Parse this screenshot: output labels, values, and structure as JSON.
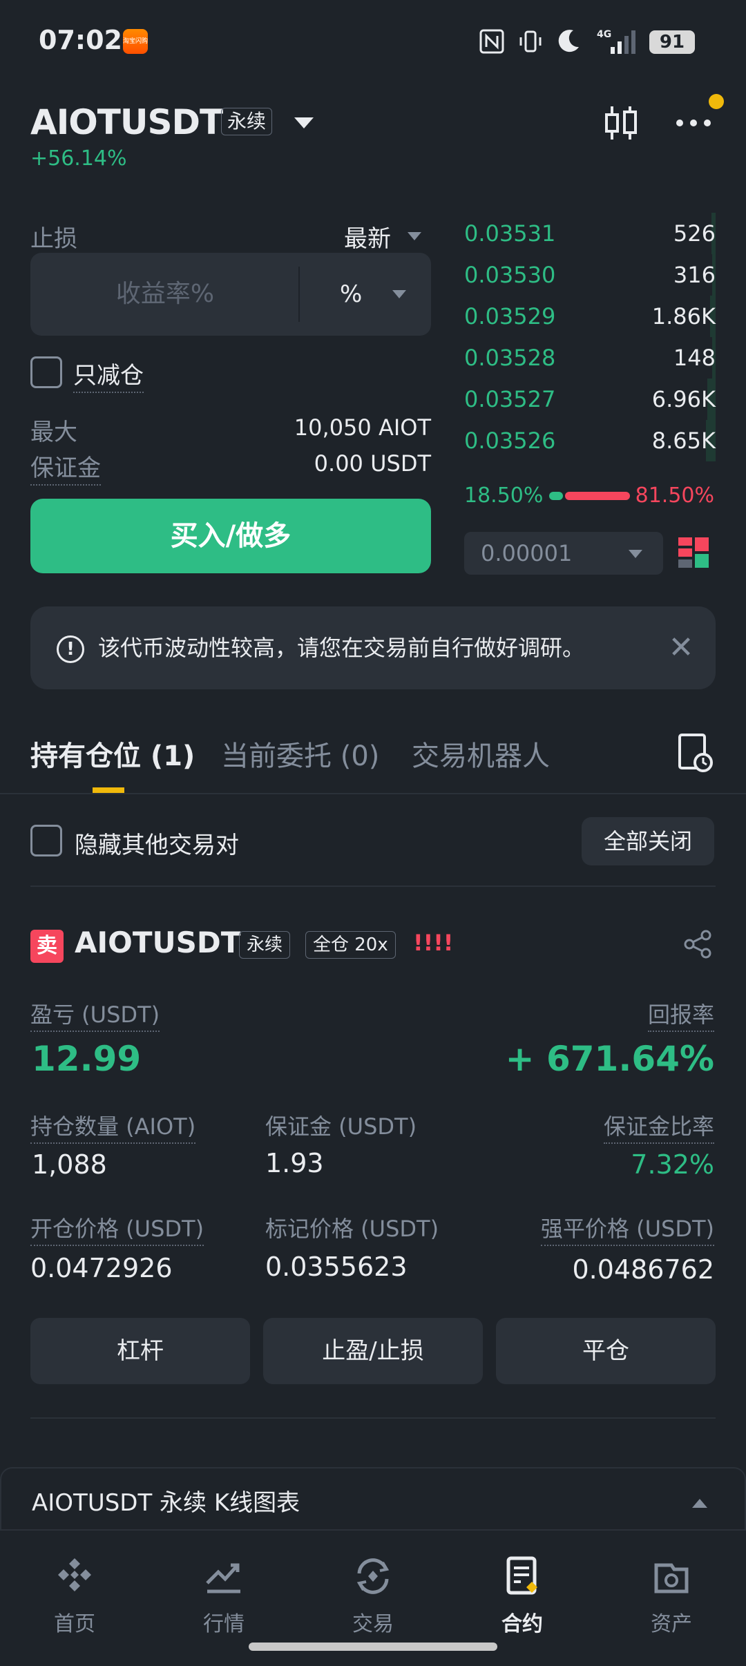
{
  "status_bar": {
    "time": "07:02",
    "app_icon_text": "淘宝闪购",
    "battery": "91",
    "icons": [
      "nfc-icon",
      "vibrate-icon",
      "moon-icon",
      "signal-4g-icon"
    ]
  },
  "header": {
    "pair": "AIOTUSDT",
    "tag": "永续",
    "change": "+56.14%"
  },
  "order_form": {
    "stop_label": "止损",
    "price_type": "最新",
    "input_placeholder": "收益率%",
    "unit": "%",
    "reduce_only": "只减仓",
    "max_label": "最大",
    "max_value": "10,050 AIOT",
    "margin_label": "保证金",
    "margin_value": "0.00 USDT",
    "buy_label": "买入/做多"
  },
  "order_book": {
    "rows": [
      {
        "price": "0.03531",
        "qty": "526",
        "depth": 0.2
      },
      {
        "price": "0.03530",
        "qty": "316",
        "depth": 0.12
      },
      {
        "price": "0.03529",
        "qty": "1.86K",
        "depth": 0.4
      },
      {
        "price": "0.03528",
        "qty": "148",
        "depth": 0.05
      },
      {
        "price": "0.03527",
        "qty": "6.96K",
        "depth": 0.8
      },
      {
        "price": "0.03526",
        "qty": "8.65K",
        "depth": 1.0
      }
    ],
    "buy_ratio": "18.50%",
    "sell_ratio": "81.50%",
    "tick": "0.00001"
  },
  "warning": {
    "text": "该代币波动性较高，请您在交易前自行做好调研。"
  },
  "tabs": [
    {
      "label": "持有仓位 (1)"
    },
    {
      "label": "当前委托 (0)"
    },
    {
      "label": "交易机器人"
    }
  ],
  "filter": {
    "hide_other": "隐藏其他交易对",
    "close_all": "全部关闭"
  },
  "position": {
    "side": "卖",
    "pair": "AIOTUSDT",
    "tag_type": "永续",
    "tag_margin": "全仓 20x",
    "alerts": "!!!!",
    "pnl_label": "盈亏 (USDT)",
    "pnl_value": "12.99",
    "roe_label": "回报率",
    "roe_value": "+ 671.64%",
    "size_label": "持仓数量 (AIOT)",
    "size_value": "1,088",
    "margin_label": "保证金 (USDT)",
    "margin_value": "1.93",
    "margin_ratio_label": "保证金比率",
    "margin_ratio_value": "7.32%",
    "entry_label": "开仓价格 (USDT)",
    "entry_value": "0.0472926",
    "mark_label": "标记价格 (USDT)",
    "mark_value": "0.0355623",
    "liq_label": "强平价格 (USDT)",
    "liq_value": "0.0486762",
    "btn_leverage": "杠杆",
    "btn_tpsl": "止盈/止损",
    "btn_close": "平仓"
  },
  "chart_drawer": {
    "title": "AIOTUSDT 永续 K线图表"
  },
  "nav": [
    {
      "label": "首页",
      "icon": "home-icon"
    },
    {
      "label": "行情",
      "icon": "markets-icon"
    },
    {
      "label": "交易",
      "icon": "trade-icon"
    },
    {
      "label": "合约",
      "icon": "futures-icon"
    },
    {
      "label": "资产",
      "icon": "wallet-icon"
    }
  ],
  "colors": {
    "background": "#1e2329",
    "green": "#2ebd85",
    "red": "#f6465d",
    "accent": "#f0b90b"
  }
}
